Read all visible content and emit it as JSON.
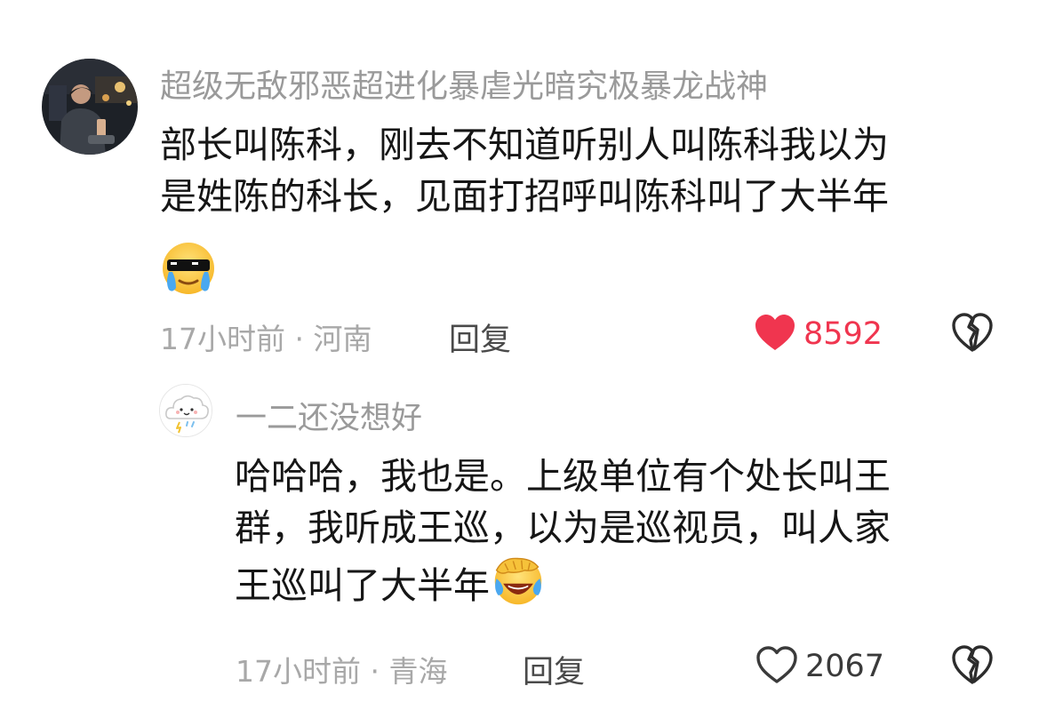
{
  "comments": [
    {
      "username": "超级无敌邪恶超进化暴虐光暗究极暴龙战神",
      "lines": [
        "部长叫陈科，刚去不知道听别人叫陈科我以为",
        "是姓陈的科长，见面打招呼叫陈科叫了大半年"
      ],
      "emoji": "cool-crying-face",
      "time": "17小时前",
      "location": "河南",
      "meta_separator": "·",
      "reply_label": "回复",
      "likes": "8592",
      "liked": true
    },
    {
      "username": "一二还没想好",
      "lines": [
        "哈哈哈，我也是。上级单位有个处长叫王",
        "群，我听成王巡，以为是巡视员，叫人家",
        "王巡叫了大半年"
      ],
      "emoji": "facepalm-laugh-face",
      "time": "17小时前",
      "location": "青海",
      "meta_separator": "·",
      "reply_label": "回复",
      "likes": "2067",
      "liked": false
    }
  ],
  "colors": {
    "liked_red": "#f0354f",
    "meta_gray": "#a8a8a8",
    "username_gray": "#9a9a9a",
    "text_black": "#161616"
  },
  "icons": [
    "heart-icon",
    "broken-heart-icon",
    "cool-crying-face-emoji",
    "facepalm-laugh-face-emoji"
  ]
}
